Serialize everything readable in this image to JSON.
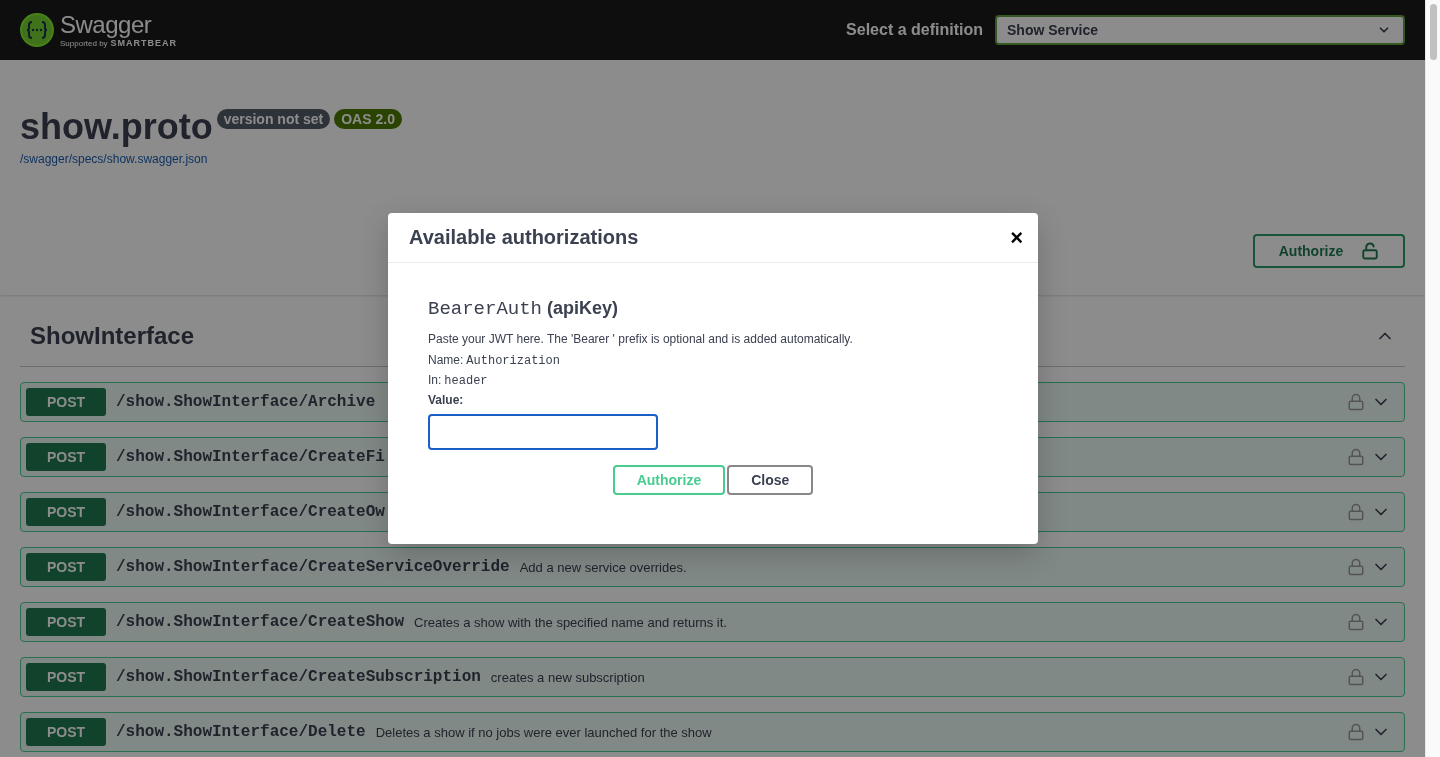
{
  "topbar": {
    "logo": {
      "name": "Swagger",
      "tagline": "Supported by",
      "brand": "SMARTBEAR"
    },
    "definition_label": "Select a definition",
    "definition_select": {
      "value": "Show Service"
    }
  },
  "info": {
    "title": "show.proto",
    "version_badge": "version not set",
    "oas_badge": "OAS 2.0",
    "spec_link": "/swagger/specs/show.swagger.json"
  },
  "authorize_button": {
    "label": "Authorize"
  },
  "section": {
    "title": "ShowInterface",
    "expanded": true
  },
  "operations": [
    {
      "method": "POST",
      "path": "/show.ShowInterface/Archive"
    },
    {
      "method": "POST",
      "path": "/show.ShowInterface/CreateFi"
    },
    {
      "method": "POST",
      "path": "/show.ShowInterface/CreateOw"
    },
    {
      "method": "POST",
      "path": "/show.ShowInterface/CreateServiceOverride",
      "summary": "Add a new service overrides."
    },
    {
      "method": "POST",
      "path": "/show.ShowInterface/CreateShow",
      "summary": "Creates a show with the specified name and returns it."
    },
    {
      "method": "POST",
      "path": "/show.ShowInterface/CreateSubscription",
      "summary": "creates a new subscription"
    },
    {
      "method": "POST",
      "path": "/show.ShowInterface/Delete",
      "summary": "Deletes a show if no jobs were ever launched for the show"
    }
  ],
  "dialog": {
    "title": "Available authorizations",
    "close_symbol": "×",
    "scheme_name": "BearerAuth",
    "scheme_type": "(apiKey)",
    "description": "Paste your JWT here. The 'Bearer ' prefix is optional and is added automatically.",
    "name_label": "Name:",
    "name_value": "Authorization",
    "in_label": "In:",
    "in_value": "header",
    "value_label": "Value:",
    "value_input": {
      "focused": true
    },
    "buttons": [
      {
        "kind": "authorize",
        "label": "Authorize"
      },
      {
        "kind": "close",
        "label": "Close"
      }
    ]
  }
}
